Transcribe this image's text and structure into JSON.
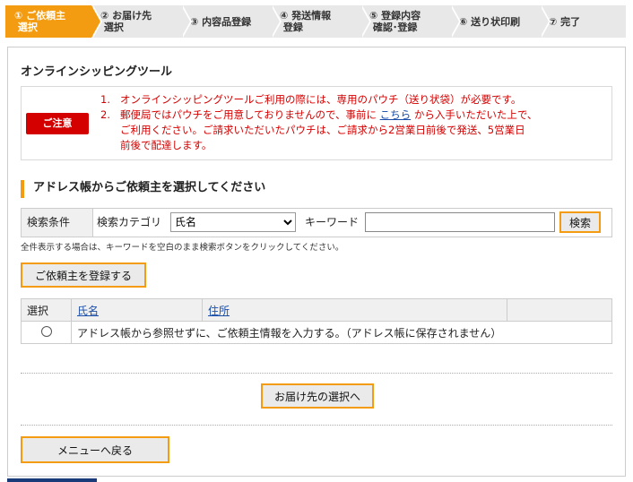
{
  "steps": [
    {
      "label": "① ご依頼主\n 選択",
      "active": true
    },
    {
      "label": "② お届け先\n 選択",
      "active": false
    },
    {
      "label": "③ 内容品登録",
      "active": false
    },
    {
      "label": "④ 発送情報\n 登録",
      "active": false
    },
    {
      "label": "⑤ 登録内容\n 確認･登録",
      "active": false
    },
    {
      "label": "⑥ 送り状印刷",
      "active": false
    },
    {
      "label": "⑦ 完了",
      "active": false
    }
  ],
  "tool_title": "オンラインシッピングツール",
  "notice": {
    "badge": "ご注意",
    "item1_num": "1.",
    "item1": "オンラインシッピングツールご利用の際には、専用のパウチ（送り状袋）が必要です。",
    "item2_num": "2.",
    "item2_a": "郵便局ではパウチをご用意しておりませんので、事前に",
    "item2_link": "こちら",
    "item2_b": "から入手いただいた上で、",
    "item2_c": "ご利用ください。ご請求いただいたパウチは、ご請求から2営業日前後で発送、5営業日",
    "item2_d": "前後で配達します。"
  },
  "section_title": "アドレス帳からご依頼主を選択してください",
  "search": {
    "condition_label": "検索条件",
    "category_label": "検索カテゴリ",
    "category_value": "氏名",
    "keyword_label": "キーワード",
    "keyword_value": "",
    "button": "検索"
  },
  "hint": "全件表示する場合は、キーワードを空白のまま検索ボタンをクリックしてください。",
  "register_button": "ご依頼主を登録する",
  "table": {
    "headers": [
      "選択",
      "氏名",
      "住所"
    ],
    "row_text": "アドレス帳から参照せずに、ご依頼主情報を入力する。（アドレス帳に保存されません）"
  },
  "next_button": "お届け先の選択へ",
  "menu_button": "メニューへ戻る",
  "colors": {
    "accent": "#f39c12",
    "alert": "#d40000",
    "link": "#1a4ea8"
  }
}
